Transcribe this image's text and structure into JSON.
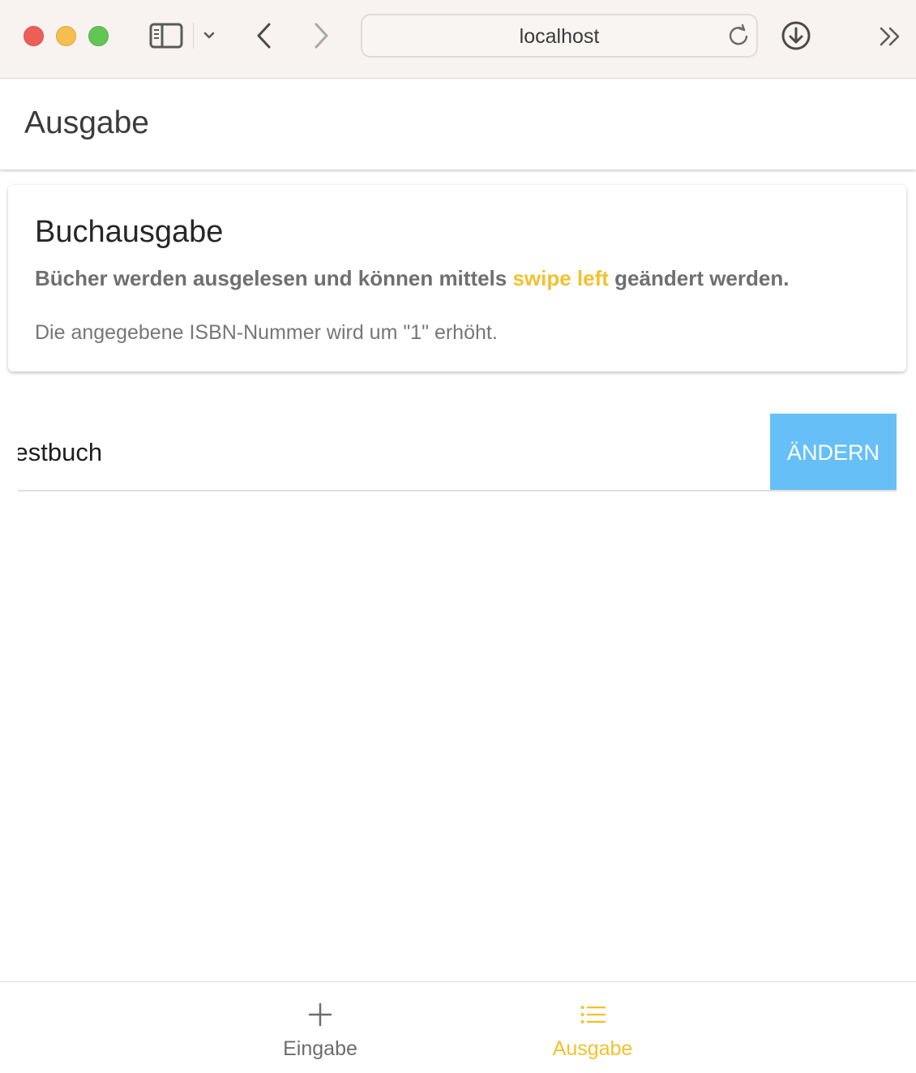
{
  "browser": {
    "url": "localhost",
    "icons": [
      "sidebar-icon",
      "chevron-down-icon",
      "back-icon",
      "forward-icon",
      "reload-icon",
      "download-icon",
      "more-icon"
    ]
  },
  "header": {
    "title": "Ausgabe"
  },
  "card": {
    "title": "Buchausgabe",
    "subtitle_before": "Bücher werden ausgelesen und können mittels ",
    "subtitle_accent": "swipe left",
    "subtitle_after": " geändert werden.",
    "text": "Die angegebene ISBN-Nummer wird um \"1\" erhöht."
  },
  "list": {
    "items": [
      {
        "label": "Testbuch",
        "option_label": "ÄNDERN"
      }
    ]
  },
  "tabs": [
    {
      "label": "Eingabe",
      "icon": "plus-icon",
      "selected": false
    },
    {
      "label": "Ausgabe",
      "icon": "list-icon",
      "selected": true
    }
  ],
  "colors": {
    "accent": "#f2c12e",
    "option_button": "#67bff8",
    "toolbar": "#f8f3f0"
  }
}
